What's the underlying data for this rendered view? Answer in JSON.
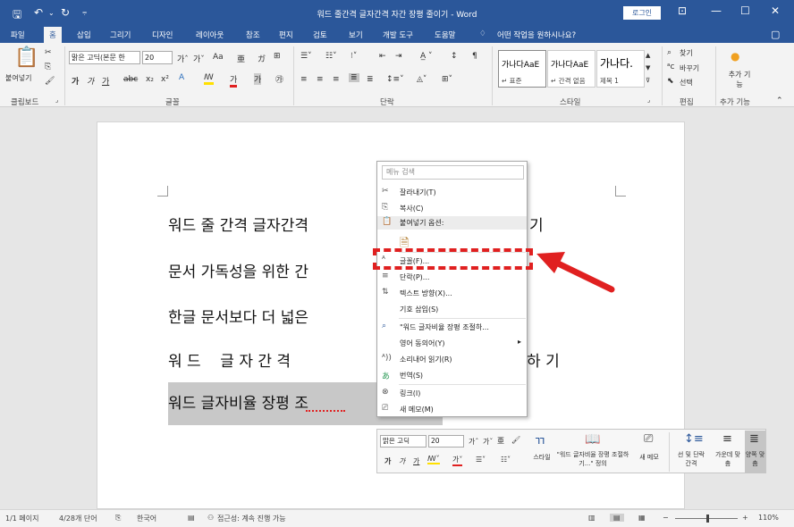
{
  "titlebar": {
    "title": "워드 줄간격 글자간격 자간 장평 줄이기 - Word",
    "login_label": "로그인",
    "save_icon": "save-icon",
    "undo_icon": "undo-icon",
    "redo_icon": "redo-icon",
    "quick_access_icon": "customize-icon",
    "ribbon_display_icon": "ribbon-display-icon",
    "minimize_icon": "minimize-icon",
    "restore_icon": "restore-icon",
    "close_icon": "close-icon"
  },
  "tabs": [
    "파일",
    "홈",
    "삽입",
    "그리기",
    "디자인",
    "레이아웃",
    "참조",
    "편지",
    "검토",
    "보기",
    "개발 도구",
    "도움말"
  ],
  "tell_me": "어떤 작업을 원하시나요?",
  "ribbon": {
    "clipboard": {
      "paste_label": "붙여넣기",
      "group_label": "클립보드"
    },
    "font": {
      "font_name": "맑은 고딕(본문 한",
      "font_size": "20",
      "group_label": "글꼴"
    },
    "paragraph": {
      "group_label": "단락"
    },
    "styles": {
      "items": [
        {
          "sample": "가나다AaE",
          "name": "↵ 표준"
        },
        {
          "sample": "가나다AaE",
          "name": "↵ 간격 없음"
        },
        {
          "sample": "가나다.",
          "name": "제목 1"
        }
      ],
      "group_label": "스타일"
    },
    "editing": {
      "find_label": "찾기",
      "replace_label": "바꾸기",
      "select_label": "선택",
      "group_label": "편집"
    },
    "addins": {
      "label": "추가 기능",
      "group_label": "추가 기능"
    }
  },
  "document": {
    "lines": [
      "워드 줄 간격 글자간격",
      "문서 가독성을 위한 간",
      "한글 문서보다 더 넓은",
      "워 드    글 자 간 격",
      "워드 글자비율 장평 조"
    ],
    "right_fragments": [
      "기",
      "절 하 기"
    ]
  },
  "context_menu": {
    "search_placeholder": "메뉴 검색",
    "items": [
      {
        "label": "잘라내기(T)",
        "icon": "scissors-icon"
      },
      {
        "label": "복사(C)",
        "icon": "copy-icon"
      },
      {
        "label": "붙여넣기 옵션:",
        "icon": "paste-icon"
      },
      {
        "label": "글꼴(F)...",
        "icon": "font-icon"
      },
      {
        "label": "단락(P)...",
        "icon": "paragraph-icon"
      },
      {
        "label": "텍스트 방향(X)...",
        "icon": "text-direction-icon"
      },
      {
        "label": "기호 삽입(S)",
        "icon": ""
      },
      {
        "label": "\"워드 글자비율 장평 조절하...",
        "icon": "search-icon"
      },
      {
        "label": "영어 동의어(Y)",
        "icon": ""
      },
      {
        "label": "소리내어 읽기(R)",
        "icon": "read-aloud-icon"
      },
      {
        "label": "번역(S)",
        "icon": "translate-icon"
      },
      {
        "label": "링크(I)",
        "icon": "link-icon"
      },
      {
        "label": "새 메모(M)",
        "icon": "comment-icon"
      }
    ]
  },
  "mini_toolbar": {
    "font_name": "맑은 고딕",
    "font_size": "20",
    "style_label": "스타일",
    "define_label": "\"워드 글자비율 장평 조절하기...\" 정의",
    "new_comment_label": "새 메모",
    "spacing_label": "선 및 단락 간격",
    "center_label": "가운데 맞춤",
    "justify_label": "양쪽 맞춤"
  },
  "statusbar": {
    "page": "1/1 페이지",
    "words": "4/28개 단어",
    "language": "한국어",
    "accessibility": "접근성: 계속 진행 가능",
    "zoom": "110%"
  },
  "colors": {
    "accent": "#2b579a",
    "annotation": "#e02020"
  }
}
